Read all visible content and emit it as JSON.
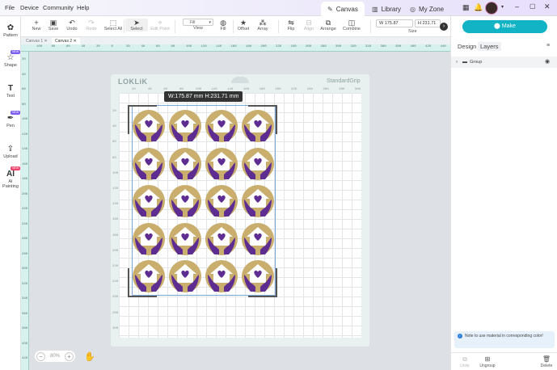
{
  "menu": [
    "File",
    "Device",
    "Community",
    "Help"
  ],
  "top_tabs": [
    {
      "label": "Canvas",
      "active": true
    },
    {
      "label": "Library",
      "active": false
    },
    {
      "label": "My Zone",
      "active": false
    }
  ],
  "toolbar": {
    "new": "New",
    "save": "Save",
    "undo": "Undo",
    "redo": "Redo",
    "select_all": "Select All",
    "select": "Select",
    "edit_point": "Edit Point",
    "view_value": "Fill",
    "view": "View",
    "fill": "Fill",
    "offset": "Offset",
    "array": "Array",
    "flip": "Flip",
    "align": "Align",
    "arrange": "Arrange",
    "combine": "Combine",
    "width_value": "175.87",
    "height_value": "231.71",
    "size": "Size"
  },
  "left_tools": [
    {
      "label": "Pattern",
      "badge": ""
    },
    {
      "label": "Shape",
      "badge": "NEW"
    },
    {
      "label": "Text",
      "badge": ""
    },
    {
      "label": "Pen",
      "badge": "NEW"
    },
    {
      "label": "Upload",
      "badge": ""
    },
    {
      "label": "AI Painting",
      "badge": "NEW"
    }
  ],
  "doc_tabs": [
    "Canvas 1",
    "Canvas 2"
  ],
  "ruler_h": [
    "100",
    "80",
    "60",
    "40",
    "20",
    "0",
    "20",
    "40",
    "60",
    "80",
    "100",
    "120",
    "140",
    "160",
    "180",
    "200",
    "220",
    "240",
    "260",
    "280",
    "300",
    "320",
    "340",
    "360",
    "380",
    "400",
    "420",
    "440",
    "460",
    "480"
  ],
  "ruler_v": [
    "20",
    "40",
    "60",
    "80",
    "100",
    "120",
    "140",
    "160",
    "180",
    "200",
    "220",
    "240",
    "260",
    "280",
    "300",
    "320",
    "340",
    "360",
    "380",
    "400",
    "420"
  ],
  "mat": {
    "brand": "LOKLiK",
    "grip": "StandardGrip",
    "top_scale": [
      "20",
      "40",
      "60",
      "80",
      "100",
      "120",
      "140",
      "160",
      "180",
      "200",
      "220",
      "240",
      "260",
      "280",
      "300"
    ],
    "left_scale": [
      "20",
      "40",
      "60",
      "80",
      "100",
      "120",
      "140",
      "160",
      "180",
      "200",
      "220",
      "240",
      "260",
      "280",
      "300"
    ]
  },
  "dimension_tooltip": "W:175.87 mm  H:231.71 mm",
  "zoom": {
    "value": "80%",
    "minus": "−",
    "plus": "+"
  },
  "right_panel": {
    "make": "Make",
    "tabs": [
      "Design",
      "Layers"
    ],
    "layer_name": "Group",
    "note": "Note to use material in corresponding color!",
    "bottom": [
      "Unite",
      "Ungroup",
      "Delete"
    ]
  },
  "colors": {
    "accent": "#12b3c4",
    "purple": "#5e2d91",
    "gold": "#c9ae6e",
    "ruler": "#d7f1ee"
  }
}
